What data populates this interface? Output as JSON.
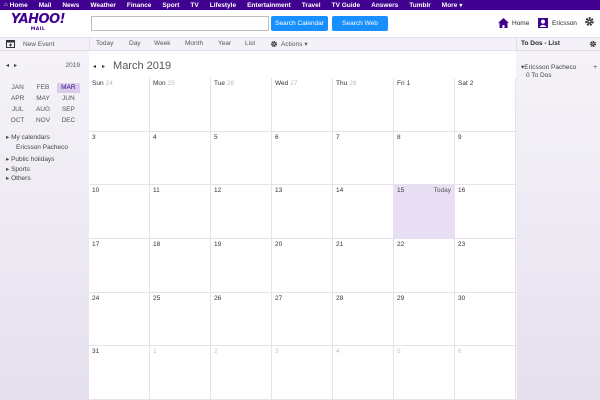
{
  "topnav": {
    "items": [
      "Home",
      "Mail",
      "News",
      "Weather",
      "Finance",
      "Sport",
      "TV",
      "Lifestyle",
      "Entertainment",
      "Travel",
      "TV Guide",
      "Answers",
      "Tumblr",
      "More"
    ]
  },
  "header": {
    "logo_text": "YAHOO!",
    "logo_sub": "MAIL",
    "search_placeholder": "",
    "search_calendar_label": "Search Calendar",
    "search_web_label": "Search Web",
    "home_label": "Home",
    "user_label": "Ericsson"
  },
  "toolbar": {
    "new_event": "New Event",
    "views": [
      "Today",
      "Day",
      "Week",
      "Month",
      "Year",
      "List"
    ],
    "actions": "Actions",
    "todo_title": "To Dos - List"
  },
  "sidebar": {
    "year": "2019",
    "months": [
      "JAN",
      "FEB",
      "MAR",
      "APR",
      "MAY",
      "JUN",
      "JUL",
      "AUG",
      "SEP",
      "OCT",
      "NOV",
      "DEC"
    ],
    "active_month": "MAR",
    "my_calendars": "My calendars",
    "calendar_owner": "Ericsson Pacheco",
    "public_holidays": "Public holidays",
    "sports": "Sports",
    "others": "Others"
  },
  "calendar": {
    "title": "March 2019",
    "weeks": [
      [
        {
          "day": "Sun",
          "num": "24"
        },
        {
          "day": "Mon",
          "num": "25"
        },
        {
          "day": "Tue",
          "num": "26"
        },
        {
          "day": "Wed",
          "num": "27"
        },
        {
          "day": "Thu",
          "num": "28"
        },
        {
          "day": "Fri",
          "num": "1"
        },
        {
          "day": "Sat",
          "num": "2"
        }
      ],
      [
        "3",
        "4",
        "5",
        "6",
        "7",
        "8",
        "9"
      ],
      [
        "10",
        "11",
        "12",
        "13",
        "14",
        "15",
        "16"
      ],
      [
        "17",
        "18",
        "19",
        "20",
        "21",
        "22",
        "23"
      ],
      [
        "24",
        "25",
        "26",
        "27",
        "28",
        "29",
        "30"
      ],
      [
        "31",
        "1",
        "2",
        "3",
        "4",
        "5",
        "6"
      ]
    ],
    "today_label": "Today"
  },
  "todos": {
    "owner": "Ericsson Pacheco",
    "count": "0 To Dos"
  },
  "colors": {
    "brand": "#400090",
    "button": "#188fff",
    "today_bg": "#e9dff5",
    "active_month_bg": "#d9cdea"
  }
}
